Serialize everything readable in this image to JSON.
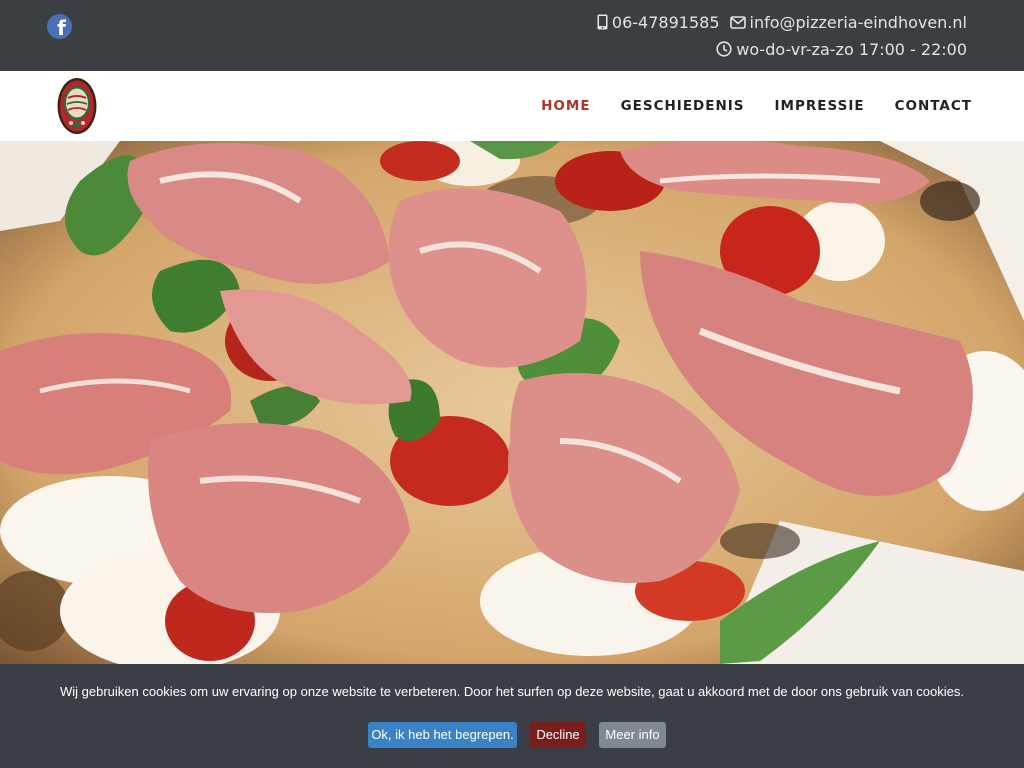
{
  "topbar": {
    "social_icon": "facebook-icon",
    "phone_icon": "mobile-phone-icon",
    "phone": "06-47891585",
    "email_icon": "envelope-icon",
    "email": "info@pizzeria-eindhoven.nl",
    "hours_icon": "clock-icon",
    "hours": "wo-do-vr-za-zo 17:00 - 22:00"
  },
  "nav": {
    "items": [
      {
        "label": "HOME",
        "active": true
      },
      {
        "label": "GESCHIEDENIS",
        "active": false
      },
      {
        "label": "IMPRESSIE",
        "active": false
      },
      {
        "label": "CONTACT",
        "active": false
      }
    ]
  },
  "cookie": {
    "message": "Wij gebruiken cookies om uw ervaring op onze website te verbeteren. Door het surfen op deze website, gaat u akkoord met de door ons gebruik van cookies.",
    "accept": "Ok, ik heb het begrepen.",
    "decline": "Decline",
    "info": "Meer info"
  },
  "colors": {
    "topbar_bg": "#3b3e42",
    "accent_active": "#b0342c",
    "facebook_blue": "#4a6fb5",
    "cookie_bg": "#3b3f45",
    "btn_accept": "#3a82c6",
    "btn_decline": "#7a1d1d",
    "btn_info": "#7f8a8f"
  }
}
